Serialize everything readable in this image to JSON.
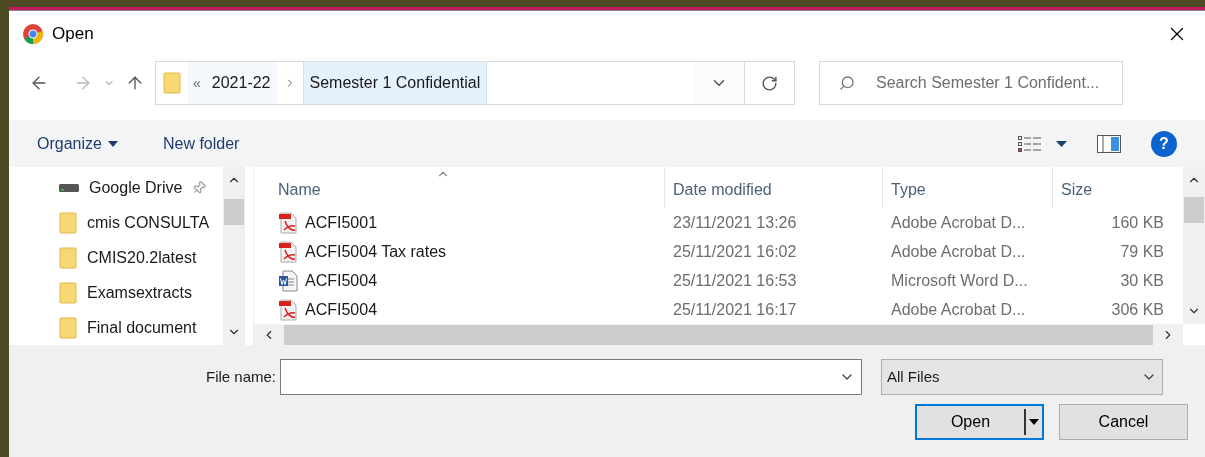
{
  "window": {
    "title": "Open"
  },
  "address": {
    "overflow": "«",
    "crumbs": [
      {
        "label": "2021-22",
        "selected": false
      },
      {
        "label": "Semester 1 Confidential",
        "selected": true
      }
    ]
  },
  "search": {
    "placeholder": "Search Semester 1 Confident..."
  },
  "toolbar": {
    "organize": "Organize",
    "new_folder": "New folder",
    "help": "?"
  },
  "sidebar": {
    "items": [
      {
        "kind": "drive",
        "label": "Google Drive",
        "pinned": true
      },
      {
        "kind": "folder",
        "label": "cmis CONSULTA",
        "pinned": false
      },
      {
        "kind": "folder",
        "label": "CMIS20.2latest",
        "pinned": false
      },
      {
        "kind": "folder",
        "label": "Examsextracts",
        "pinned": false
      },
      {
        "kind": "folder",
        "label": "Final document",
        "pinned": false
      }
    ]
  },
  "table": {
    "columns": [
      "Name",
      "Date modified",
      "Type",
      "Size"
    ],
    "rows": [
      {
        "kind": "pdf",
        "name": "ACFI5001",
        "date": "23/11/2021 13:26",
        "type": "Adobe Acrobat D...",
        "size": "160 KB"
      },
      {
        "kind": "pdf",
        "name": "ACFI5004 Tax rates",
        "date": "25/11/2021 16:02",
        "type": "Adobe Acrobat D...",
        "size": "79 KB"
      },
      {
        "kind": "word",
        "name": "ACFI5004",
        "date": "25/11/2021 16:53",
        "type": "Microsoft Word D...",
        "size": "30 KB"
      },
      {
        "kind": "pdf",
        "name": "ACFI5004",
        "date": "25/11/2021 16:17",
        "type": "Adobe Acrobat D...",
        "size": "306 KB"
      }
    ]
  },
  "footer": {
    "file_name_label": "File name:",
    "filter": "All Files",
    "buttons": [
      "Open",
      "Cancel"
    ]
  }
}
